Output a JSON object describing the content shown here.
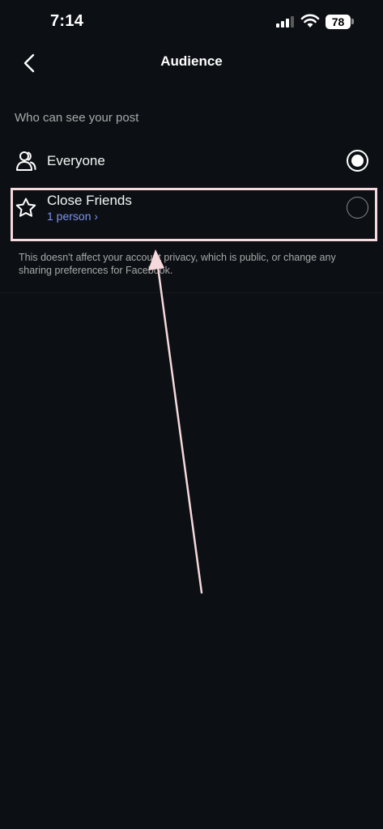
{
  "status_bar": {
    "time": "7:14",
    "battery": "78"
  },
  "header": {
    "title": "Audience",
    "back_icon": "chevron-left-icon"
  },
  "section": {
    "heading": "Who can see your post"
  },
  "options": [
    {
      "label": "Everyone",
      "icon": "people-icon",
      "selected": true
    },
    {
      "label": "Close Friends",
      "sublabel": "1 person ›",
      "icon": "star-icon",
      "selected": false
    }
  ],
  "footnote": "This doesn't affect your account privacy, which is public, or change any sharing preferences for Facebook.",
  "colors": {
    "background": "#0c1014",
    "text": "#f5f5f5",
    "muted": "#a8a8a8",
    "link": "#7f93f5",
    "annotation": "#f6d9dc"
  }
}
